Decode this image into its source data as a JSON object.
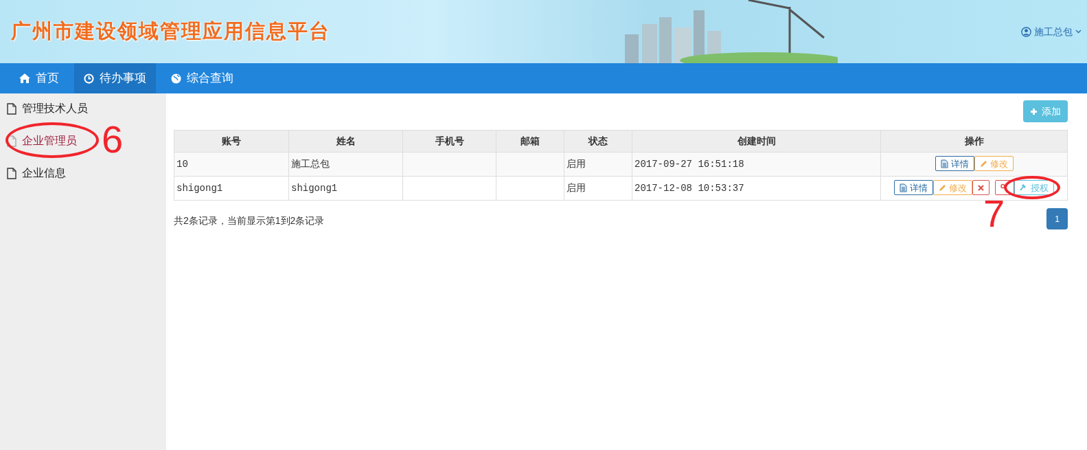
{
  "header": {
    "title": "广州市建设领域管理应用信息平台",
    "user": "施工总包"
  },
  "nav": [
    {
      "label": "首页",
      "selected": false
    },
    {
      "label": "待办事项",
      "selected": true
    },
    {
      "label": "综合查询",
      "selected": false
    }
  ],
  "sidebar": {
    "items": [
      {
        "label": "管理技术人员",
        "selected": false
      },
      {
        "label": "企业管理员",
        "selected": true
      },
      {
        "label": "企业信息",
        "selected": false
      }
    ]
  },
  "toolbar": {
    "add_button": "添加"
  },
  "table": {
    "columns": [
      "账号",
      "姓名",
      "手机号",
      "邮箱",
      "状态",
      "创建时间",
      "操作"
    ],
    "rows": [
      {
        "cells": [
          "10",
          "施工总包",
          "",
          "",
          "启用",
          "2017-09-27 16:51:18"
        ],
        "actions": [
          {
            "kind": "detail",
            "label": "详情"
          },
          {
            "kind": "edit",
            "label": "修改"
          }
        ]
      },
      {
        "cells": [
          "shigong1",
          "shigong1",
          "",
          "",
          "启用",
          "2017-12-08 10:53:37"
        ],
        "actions": [
          {
            "kind": "detail",
            "label": "详情"
          },
          {
            "kind": "edit",
            "label": "修改"
          },
          {
            "kind": "delete"
          },
          {
            "kind": "key"
          },
          {
            "kind": "grant",
            "label": "授权"
          }
        ]
      }
    ]
  },
  "footer": {
    "summary": "共2条记录，当前显示第1到2条记录",
    "pages": [
      {
        "label": "1",
        "selected": true
      }
    ]
  },
  "annotations": [
    {
      "label": "6"
    },
    {
      "label": "7"
    }
  ]
}
